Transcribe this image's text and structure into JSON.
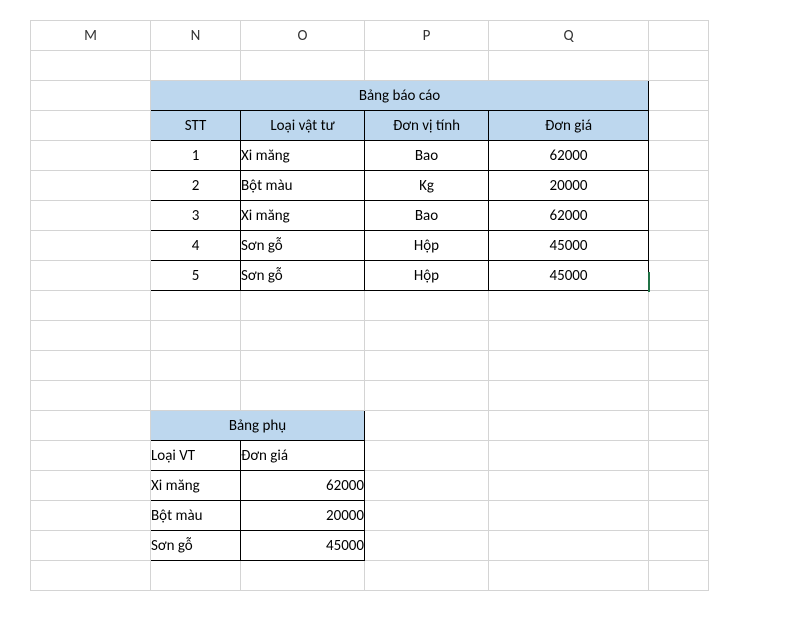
{
  "columnHeaders": {
    "M": "M",
    "N": "N",
    "O": "O",
    "P": "P",
    "Q": "Q"
  },
  "table1": {
    "title": "Bảng báo cáo",
    "headers": {
      "stt": "STT",
      "loaiVT": "Loại vật tư",
      "donViTinh": "Đơn vị tính",
      "donGia": "Đơn giá"
    },
    "rows": [
      {
        "stt": "1",
        "loaiVT": "Xi măng",
        "donViTinh": "Bao",
        "donGia": "62000"
      },
      {
        "stt": "2",
        "loaiVT": "Bột màu",
        "donViTinh": "Kg",
        "donGia": "20000"
      },
      {
        "stt": "3",
        "loaiVT": "Xi măng",
        "donViTinh": "Bao",
        "donGia": "62000"
      },
      {
        "stt": "4",
        "loaiVT": "Sơn gỗ",
        "donViTinh": "Hộp",
        "donGia": "45000"
      },
      {
        "stt": "5",
        "loaiVT": "Sơn gỗ",
        "donViTinh": "Hộp",
        "donGia": "45000"
      }
    ]
  },
  "table2": {
    "title": "Bảng phụ",
    "headers": {
      "loaiVT": "Loại VT",
      "donGia": "Đơn giá"
    },
    "rows": [
      {
        "loaiVT": "Xi măng",
        "donGia": "62000"
      },
      {
        "loaiVT": "Bột màu",
        "donGia": "20000"
      },
      {
        "loaiVT": "Sơn gỗ",
        "donGia": "45000"
      }
    ]
  }
}
